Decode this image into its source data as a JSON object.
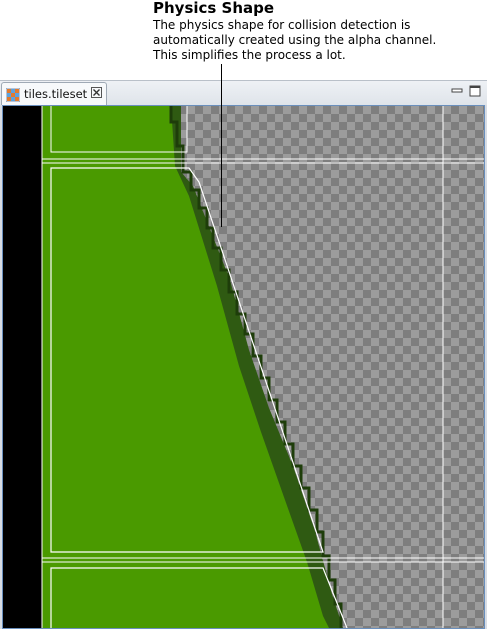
{
  "callout": {
    "title": "Physics Shape",
    "body": "The physics shape for collision detection is\nautomatically created using the alpha channel.\nThis simplifies the process a lot."
  },
  "editor": {
    "tab": {
      "label": "tiles.tileset",
      "icon": "tileset-grid-icon",
      "close_icon": "close-icon"
    },
    "view_controls": [
      "minimize-icon",
      "maximize-icon"
    ]
  },
  "colors": {
    "accent": "#6a8fbd",
    "grass": "#4a9a00",
    "grass_shade": "#2f5a12",
    "checker_light": "#9c9c9c",
    "checker_dark": "#7e7e7e",
    "hull_line": "#ffffff"
  }
}
